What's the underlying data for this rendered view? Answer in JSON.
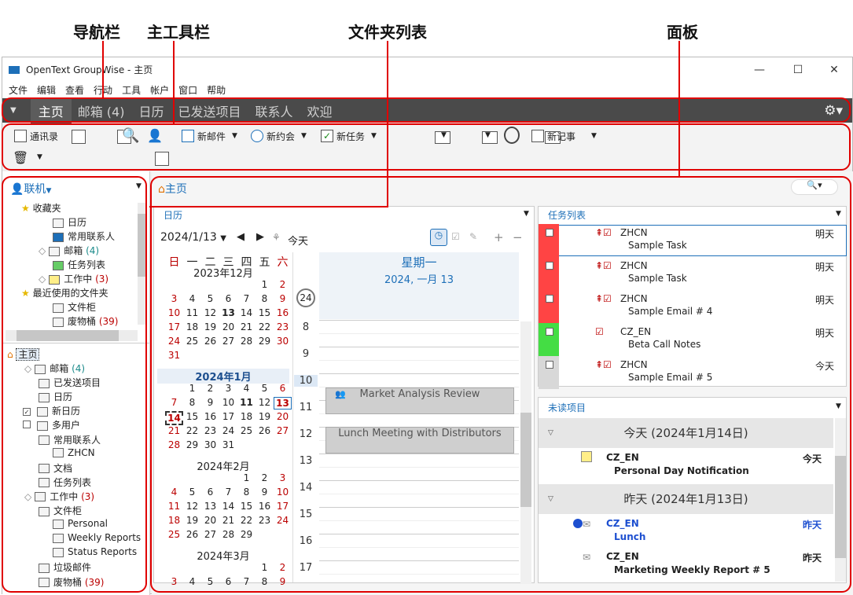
{
  "callouts": {
    "nav": "导航栏",
    "toolbar": "主工具栏",
    "folderlist": "文件夹列表",
    "panels": "面板"
  },
  "window": {
    "title": "OpenText GroupWise - 主页",
    "minimize": "—",
    "maximize": "☐",
    "close": "✕"
  },
  "menu": [
    "文件",
    "编辑",
    "查看",
    "行动",
    "工具",
    "帐户",
    "窗口",
    "帮助"
  ],
  "nav": {
    "tabs": [
      "主页",
      "邮箱 (4)",
      "日历",
      "已发送项目",
      "联系人",
      "欢迎"
    ],
    "settings": "⚙▾"
  },
  "toolbar": {
    "address_book": "通讯录",
    "new_mail": "新邮件",
    "new_appt": "新约会",
    "new_task": "新任务",
    "new_note": "新记事"
  },
  "left": {
    "online": "联机",
    "favorites": "收藏夹",
    "fav_items": [
      {
        "label": "日历"
      },
      {
        "label": "常用联系人"
      },
      {
        "label": "邮箱",
        "count": "(4)"
      },
      {
        "label": "任务列表"
      },
      {
        "label": "工作中",
        "count": "(3)"
      }
    ],
    "recent": "最近使用的文件夹",
    "recent_items": [
      {
        "label": "文件柜"
      },
      {
        "label": "废物桶",
        "count": "(39)"
      }
    ],
    "home": "主页",
    "tree": [
      {
        "label": "邮箱",
        "count": "(4)",
        "lvl": 1
      },
      {
        "label": "已发送项目",
        "lvl": 1
      },
      {
        "label": "日历",
        "lvl": 1
      },
      {
        "label": "新日历",
        "lvl": 1
      },
      {
        "label": "多用户",
        "lvl": 1
      },
      {
        "label": "常用联系人",
        "lvl": 1
      },
      {
        "label": "ZHCN",
        "lvl": 2
      },
      {
        "label": "文档",
        "lvl": 1
      },
      {
        "label": "任务列表",
        "lvl": 1
      },
      {
        "label": "工作中",
        "count": "(3)",
        "lvl": 1
      },
      {
        "label": "文件柜",
        "lvl": 1
      },
      {
        "label": "Personal",
        "lvl": 2
      },
      {
        "label": "Weekly Reports",
        "lvl": 2
      },
      {
        "label": "Status Reports",
        "lvl": 2
      },
      {
        "label": "垃圾邮件",
        "lvl": 1
      },
      {
        "label": "废物桶",
        "count": "(39)",
        "lvl": 1
      }
    ]
  },
  "main": {
    "home_title": "主页",
    "search": "🔍▾",
    "calendar": {
      "panel_title": "日历",
      "date": "2024/1/13",
      "today": "今天",
      "weekday_header": [
        "日",
        "一",
        "二",
        "三",
        "四",
        "五",
        "六"
      ],
      "months": [
        {
          "title": "2023年12月",
          "bold": false,
          "rows": [
            [
              "",
              "",
              "",
              "",
              "",
              "1",
              "2"
            ],
            [
              "3",
              "4",
              "5",
              "6",
              "7",
              "8",
              "9"
            ],
            [
              "10",
              "11",
              "12",
              "13",
              "14",
              "15",
              "16"
            ],
            [
              "17",
              "18",
              "19",
              "20",
              "21",
              "22",
              "23"
            ],
            [
              "24",
              "25",
              "26",
              "27",
              "28",
              "29",
              "30"
            ],
            [
              "31",
              "",
              "",
              "",
              "",
              "",
              ""
            ]
          ]
        },
        {
          "title": "2024年1月",
          "bold": true,
          "rows": [
            [
              "",
              "1",
              "2",
              "3",
              "4",
              "5",
              "6"
            ],
            [
              "7",
              "8",
              "9",
              "10",
              "11",
              "12",
              "13"
            ],
            [
              "14",
              "15",
              "16",
              "17",
              "18",
              "19",
              "20"
            ],
            [
              "21",
              "22",
              "23",
              "24",
              "25",
              "26",
              "27"
            ],
            [
              "28",
              "29",
              "30",
              "31",
              "",
              "",
              ""
            ]
          ]
        },
        {
          "title": "2024年2月",
          "bold": false,
          "rows": [
            [
              "",
              "",
              "",
              "",
              "1",
              "2",
              "3"
            ],
            [
              "4",
              "5",
              "6",
              "7",
              "8",
              "9",
              "10"
            ],
            [
              "11",
              "12",
              "13",
              "14",
              "15",
              "16",
              "17"
            ],
            [
              "18",
              "19",
              "20",
              "21",
              "22",
              "23",
              "24"
            ],
            [
              "25",
              "26",
              "27",
              "28",
              "29",
              "",
              ""
            ]
          ]
        },
        {
          "title": "2024年3月",
          "bold": false,
          "rows": [
            [
              "",
              "",
              "",
              "",
              "",
              "1",
              "2"
            ],
            [
              "3",
              "4",
              "5",
              "6",
              "7",
              "8",
              "9"
            ]
          ]
        }
      ],
      "day_header": "星期一",
      "day_sub": "2024, 一月 13",
      "week_no": "24",
      "hours": [
        "8",
        "9",
        "10",
        "11",
        "12",
        "13",
        "14",
        "15",
        "16",
        "17"
      ],
      "appointments": [
        "Market Analysis Review",
        "Lunch Meeting with Distributors"
      ]
    },
    "tasks": {
      "title": "任务列表",
      "rows": [
        {
          "from": "ZHCN",
          "subject": "Sample Task",
          "when": "明天",
          "color": "#ff4444"
        },
        {
          "from": "ZHCN",
          "subject": "Sample Task",
          "when": "明天",
          "color": "#ff4444"
        },
        {
          "from": "ZHCN",
          "subject": "Sample Email # 4",
          "when": "明天",
          "color": "#ff4444"
        },
        {
          "from": "CZ_EN",
          "subject": "Beta Call Notes",
          "when": "明天",
          "color": "#44dd44"
        },
        {
          "from": "ZHCN",
          "subject": "Sample Email # 5",
          "when": "今天",
          "color": "#d8d8d8"
        }
      ]
    },
    "unread": {
      "title": "未读项目",
      "groups": [
        {
          "label": "今天 (2024年1月14日)",
          "items": [
            {
              "from": "CZ_EN",
              "subject": "Personal Day Notification",
              "when": "今天",
              "blue": false
            }
          ]
        },
        {
          "label": "昨天 (2024年1月13日)",
          "items": [
            {
              "from": "CZ_EN",
              "subject": "Lunch",
              "when": "昨天",
              "blue": true
            },
            {
              "from": "CZ_EN",
              "subject": "Marketing Weekly Report # 5",
              "when": "昨天",
              "blue": false
            }
          ]
        }
      ]
    }
  }
}
